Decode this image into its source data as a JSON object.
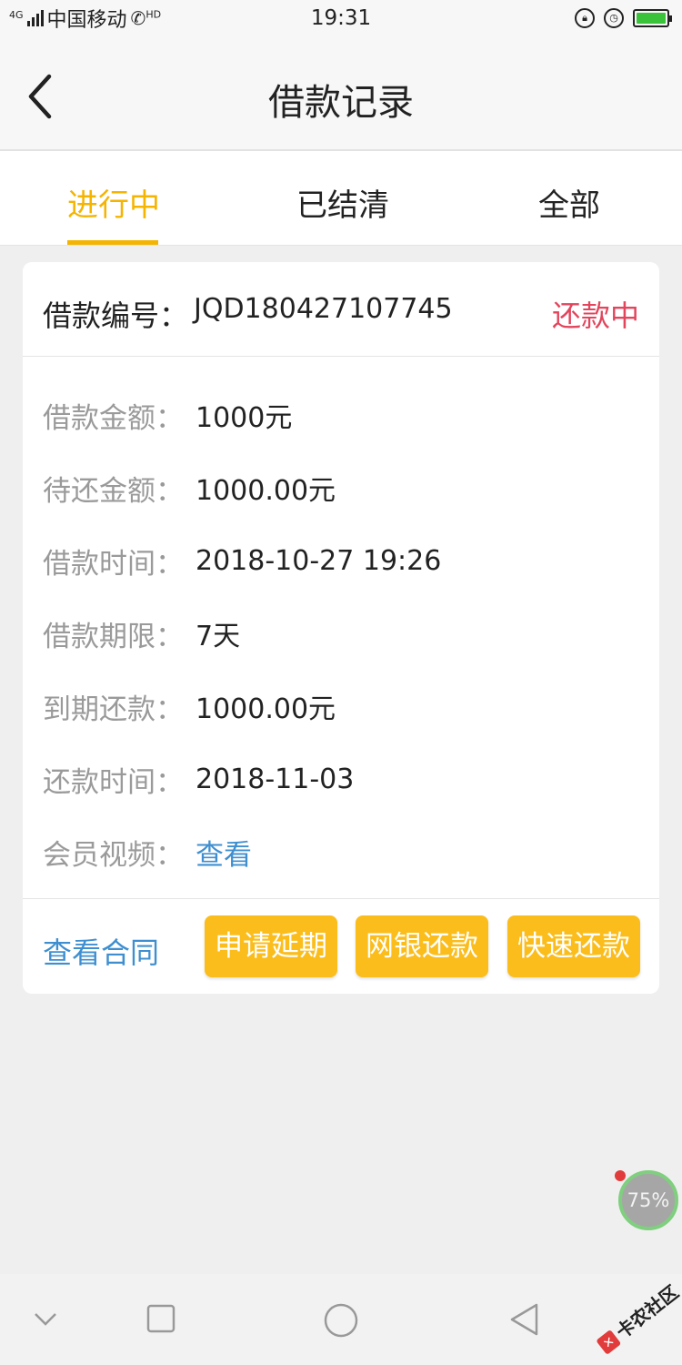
{
  "status_bar": {
    "network": "4G",
    "carrier": "中国移动",
    "hd": "HD",
    "time": "19:31"
  },
  "header": {
    "title": "借款记录"
  },
  "tabs": [
    {
      "label": "进行中",
      "active": true
    },
    {
      "label": "已结清",
      "active": false
    },
    {
      "label": "全部",
      "active": false
    }
  ],
  "loan": {
    "number_label": "借款编号：",
    "number_value": "JQD180427107745",
    "status": "还款中",
    "rows": [
      {
        "label": "借款金额：",
        "value": "1000元"
      },
      {
        "label": "待还金额：",
        "value": "1000.00元"
      },
      {
        "label": "借款时间：",
        "value": "2018-10-27 19:26"
      },
      {
        "label": "借款期限：",
        "value": "7天"
      },
      {
        "label": "到期还款：",
        "value": "1000.00元"
      },
      {
        "label": "还款时间：",
        "value": "2018-11-03"
      },
      {
        "label": "会员视频：",
        "value": "查看"
      }
    ]
  },
  "actions": {
    "contract_link": "查看合同",
    "buttons": [
      "申请延期",
      "网银还款",
      "快速还款"
    ]
  },
  "float_badge": {
    "value": "75%"
  },
  "watermark": {
    "text": "卡农社区"
  },
  "colors": {
    "accent": "#f4b400",
    "button": "#fbbd1c",
    "status": "#e2455c",
    "link": "#3f8fd0"
  }
}
